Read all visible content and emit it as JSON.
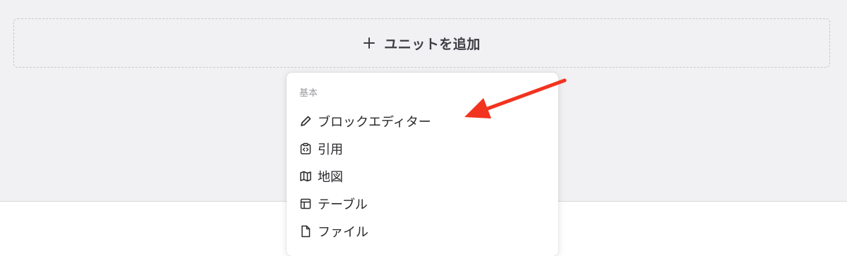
{
  "add_unit": {
    "label": "ユニットを追加",
    "icon": "plus-icon"
  },
  "menu": {
    "section_label": "基本",
    "items": [
      {
        "label": "ブロックエディター",
        "icon": "pencil-icon"
      },
      {
        "label": "引用",
        "icon": "code-clipboard-icon"
      },
      {
        "label": "地図",
        "icon": "map-icon"
      },
      {
        "label": "テーブル",
        "icon": "table-icon"
      },
      {
        "label": "ファイル",
        "icon": "file-icon"
      }
    ]
  },
  "annotation": {
    "arrow_color": "#f2331f",
    "points_to": "ブロックエディター"
  }
}
